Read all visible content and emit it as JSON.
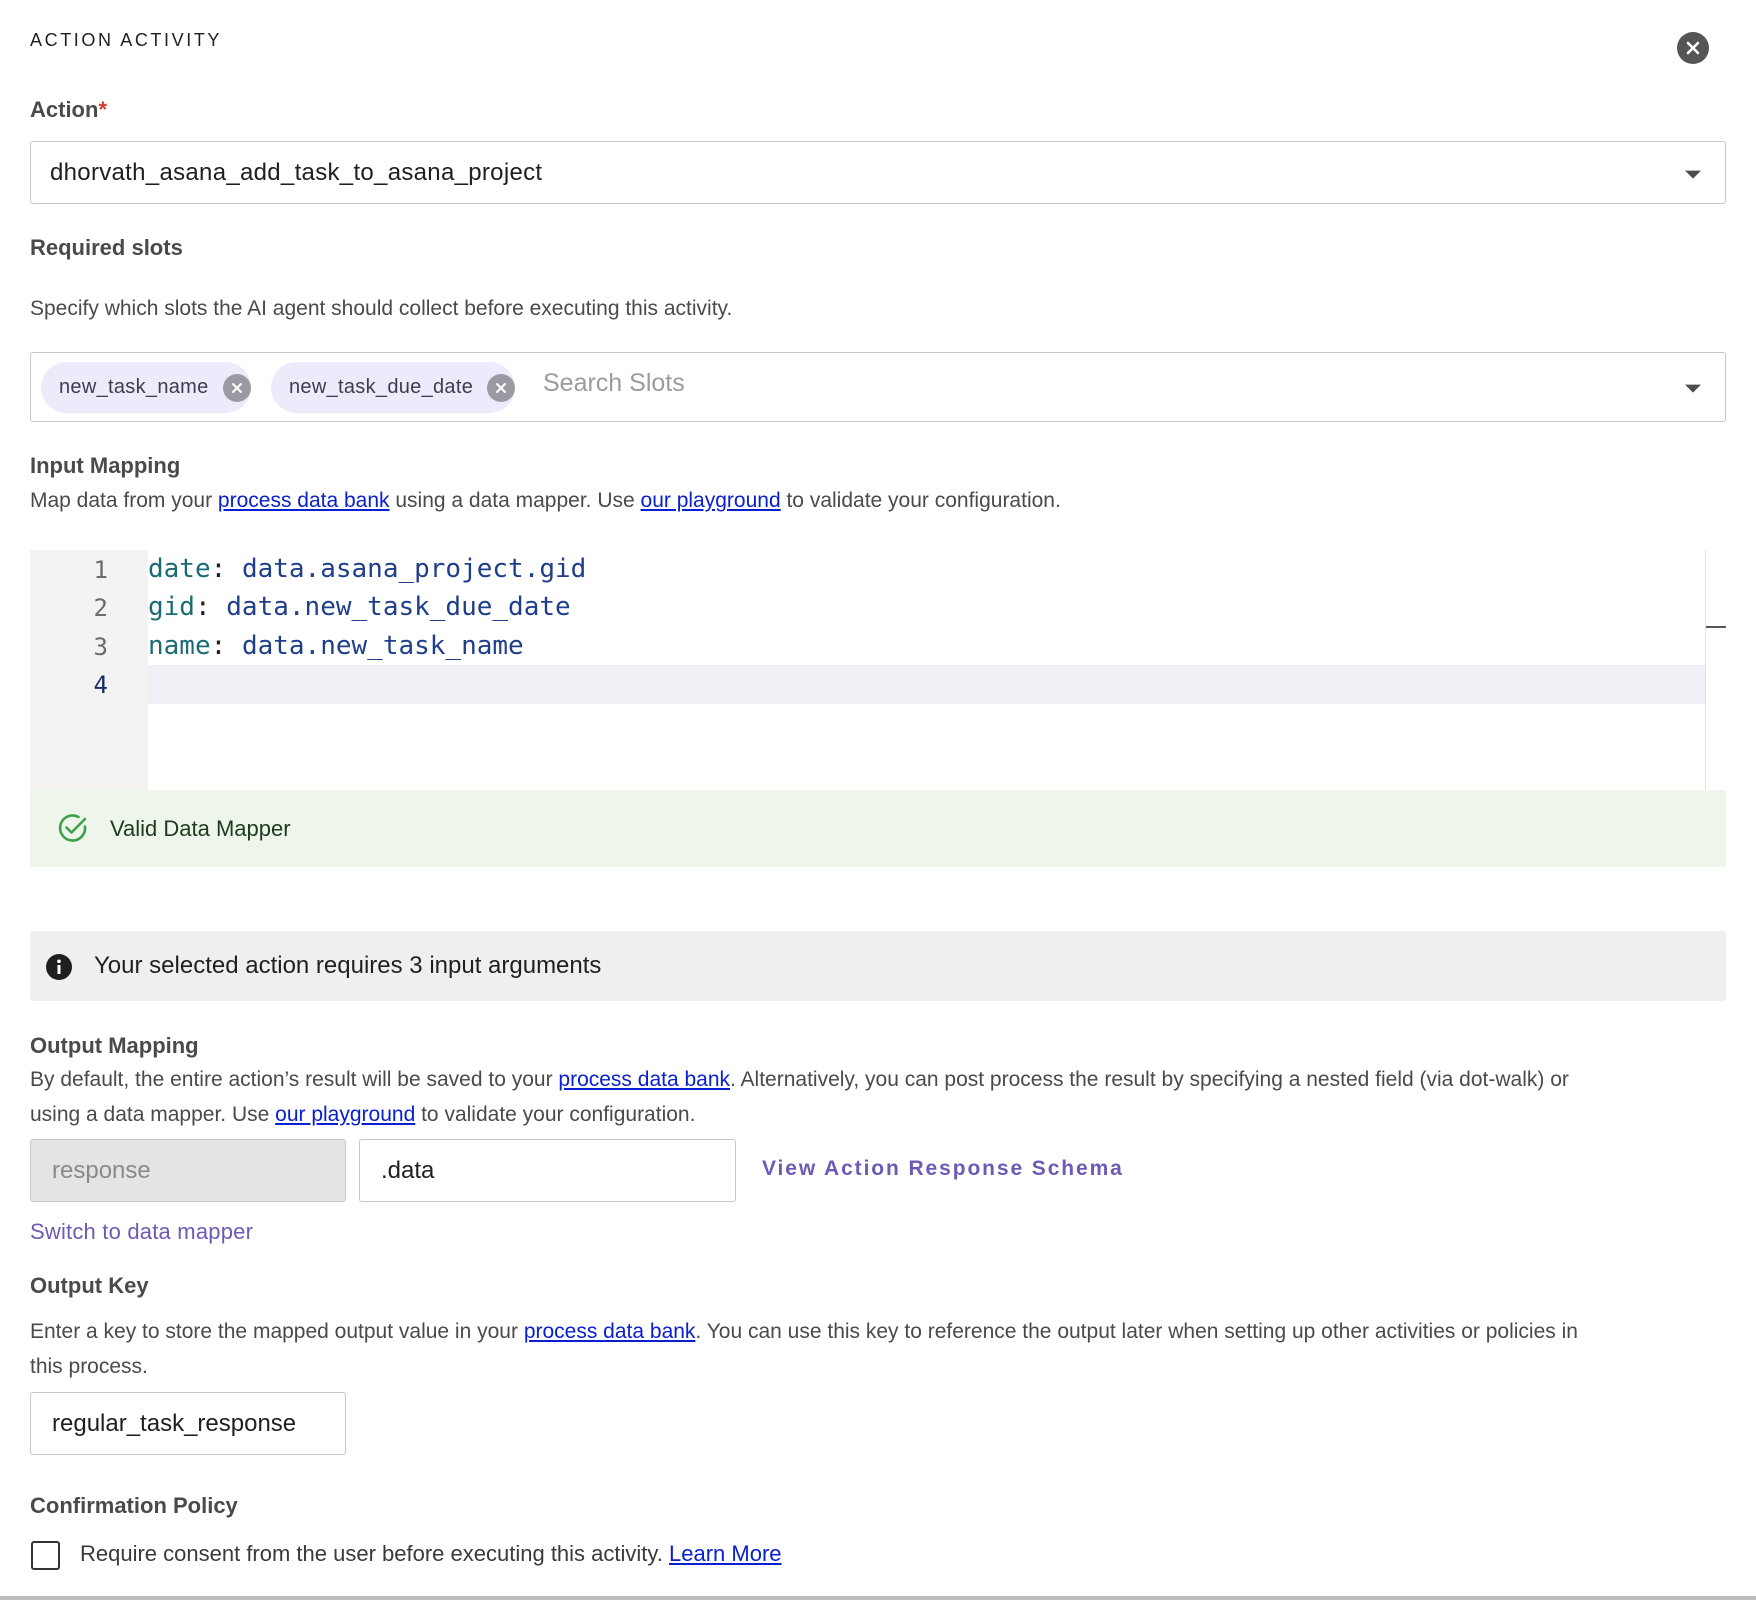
{
  "panel": {
    "title": "ACTION ACTIVITY"
  },
  "action": {
    "label": "Action",
    "required_mark": "*",
    "selected": "dhorvath_asana_add_task_to_asana_project"
  },
  "required_slots": {
    "label": "Required slots",
    "description": "Specify which slots the AI agent should collect before executing this activity.",
    "chips": [
      "new_task_name",
      "new_task_due_date"
    ],
    "placeholder": "Search Slots"
  },
  "input_mapping": {
    "label": "Input Mapping",
    "desc_prefix": "Map data from your ",
    "link_data_bank": "process data bank",
    "desc_middle": " using a data mapper. Use ",
    "link_playground": "our playground",
    "desc_suffix": " to validate your configuration.",
    "code_lines": [
      {
        "no": "1",
        "key": "date",
        "value": "data.asana_project.gid"
      },
      {
        "no": "2",
        "key": "gid",
        "value": "data.new_task_due_date"
      },
      {
        "no": "3",
        "key": "name",
        "value": "data.new_task_name"
      },
      {
        "no": "4",
        "key": "",
        "value": ""
      }
    ],
    "valid_text": "Valid Data Mapper"
  },
  "info": {
    "text": "Your selected action requires 3 input arguments"
  },
  "output_mapping": {
    "label": "Output Mapping",
    "desc_part1": "By default, the entire action’s result will be saved to your ",
    "link_data_bank": "process data bank",
    "desc_part2": ". Alternatively, you can post process the result by specifying a nested field (via dot-walk) or",
    "desc_part3": "using a data mapper. Use ",
    "link_playground": "our playground",
    "desc_part4": " to validate your configuration.",
    "prefix_value": "response",
    "path_value": ".data",
    "schema_link": "View Action Response Schema",
    "switch_link": "Switch to data mapper"
  },
  "output_key": {
    "label": "Output Key",
    "desc_part1": "Enter a key to store the mapped output value in your ",
    "link_data_bank": "process data bank",
    "desc_part2": ". You can use this key to reference the output later when setting up other activities or policies in",
    "desc_part3": "this process.",
    "value": "regular_task_response"
  },
  "confirmation": {
    "label": "Confirmation Policy",
    "consent_text": "Require consent from the user before executing this activity. ",
    "learn_more": "Learn More"
  },
  "colors": {
    "link_blue": "#0a20d0",
    "link_purple": "#6c5bb5",
    "required_red": "#d9382e",
    "valid_green": "#3ea04a",
    "chip_bg": "#efeafb"
  }
}
